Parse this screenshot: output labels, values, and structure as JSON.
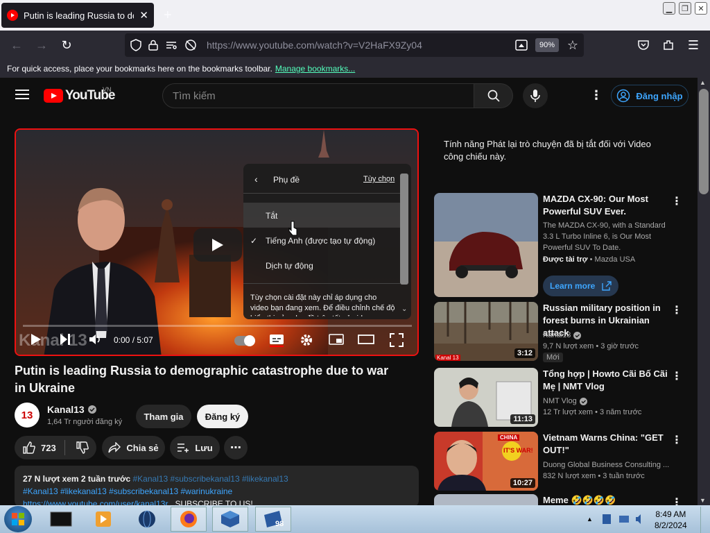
{
  "browser": {
    "tab_title": "Putin is leading Russia to demographic catastrophe due to war in Ukraine",
    "url": "https://www.youtube.com/watch?v=V2HaFX9Zy04",
    "zoom": "90%",
    "bookmarks_msg": "For quick access, place your bookmarks here on the bookmarks toolbar.",
    "bookmarks_link": "Manage bookmarks..."
  },
  "youtube": {
    "logo": "YouTube",
    "region": "VN",
    "search_placeholder": "Tìm kiếm",
    "signin": "Đăng nhập"
  },
  "player": {
    "watermark": "Kanal 13",
    "time": "0:00 / 5:07",
    "progress": 0,
    "subtitle_menu": {
      "header": "Phụ đề",
      "options_link": "Tùy chọn",
      "items": [
        {
          "label": "Tắt",
          "checked": false
        },
        {
          "label": "Tiếng Anh (được tạo tự động)",
          "checked": true
        },
        {
          "label": "Dịch tự động",
          "checked": false
        }
      ],
      "note": "Tùy chọn cài đặt này chỉ áp dụng cho video bạn đang xem. Để điều chỉnh chế độ hiển thị của phụ đề trên tất cả video"
    }
  },
  "video": {
    "title": "Putin is leading Russia to demographic catastrophe due to war in Ukraine",
    "channel": "Kanal13",
    "subscribers": "1,64 Tr người đăng ký",
    "join": "Tham gia",
    "subscribe": "Đăng ký",
    "likes": "723",
    "share": "Chia sẻ",
    "save": "Lưu",
    "views_date": "27 N lượt xem  2 tuần trước",
    "tags_line1": "#Kanal13 #subscribekanal13 #likekanal13",
    "tags_line2": "#Kanal13 #likekanal13 #subscribekanal13 #warinukraine",
    "link_line": "https://www.youtube.com/user/kanal13r",
    "subscribe_note": "SUBSCRIBE TO US!"
  },
  "chat_notice": "Tính năng Phát lại trò chuyện đã bị tắt đối với Video công chiếu này.",
  "recommendations": [
    {
      "title": "MAZDA CX-90: Our Most Powerful SUV Ever.",
      "desc": "The MAZDA CX-90, with a Standard 3.3 L Turbo Inline 6, is Our Most Powerful SUV To Date.",
      "sponsor": "Được tài trợ",
      "channel": "Mazda USA",
      "cta": "Learn more"
    },
    {
      "title": "Russian military position in forest burns in Ukrainian attack",
      "channel": "Kanal13",
      "meta": "9,7 N lượt xem • 3 giờ trước",
      "badge": "Mới",
      "duration": "3:12",
      "thumb_label": "Kanal 13"
    },
    {
      "title": "Tổng hợp | Howto Cãi Bố Cãi Mẹ | NMT Vlog",
      "channel": "NMT Vlog",
      "meta": "12 Tr lượt xem • 3 năm trước",
      "duration": "11:13"
    },
    {
      "title": "Vietnam Warns China: \"GET OUT!\"",
      "channel": "Duong Global Business Consulting ...",
      "meta": "832 N lượt xem • 3 tuần trước",
      "duration": "10:27",
      "thumb_text1": "CHINA",
      "thumb_text2": "IT'S WAR!"
    },
    {
      "title": "Meme 🤣🤣🤣🤣"
    }
  ],
  "taskbar": {
    "time": "8:49 AM",
    "date": "8/2/2024",
    "vm_badge": "98"
  },
  "colors": {
    "accent_red": "#ff0000",
    "link_blue": "#3ea6ff",
    "bg": "#0f0f0f"
  }
}
